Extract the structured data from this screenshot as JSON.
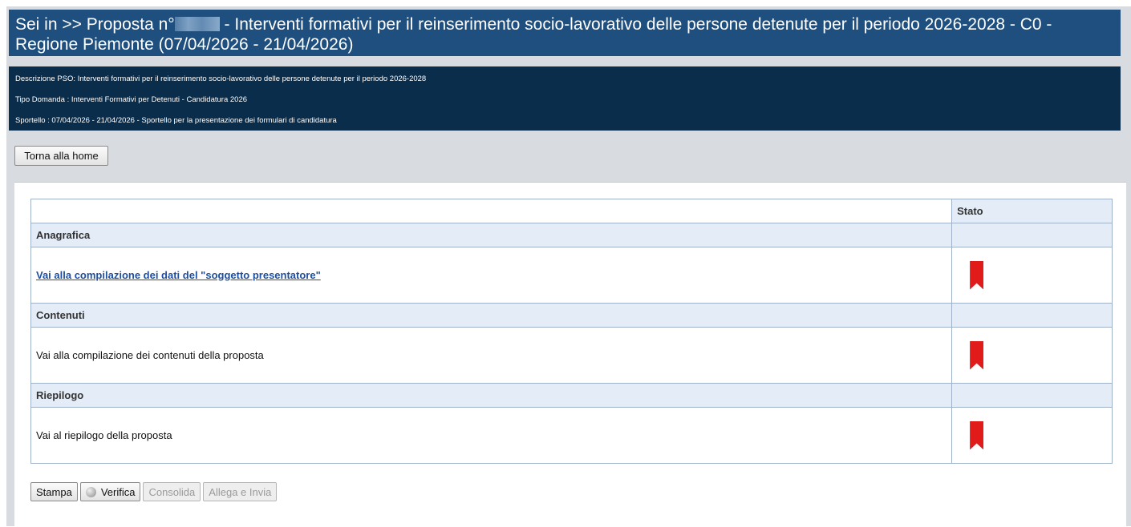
{
  "header": {
    "title_prefix": "Sei in >> Proposta n°",
    "title_suffix": " - Interventi formativi per il reinserimento socio-lavorativo delle persone detenute per il periodo 2026-2028 - C0 - Regione Piemonte (07/04/2026 - 21/04/2026)"
  },
  "info": {
    "descrizione": "Descrizione PSO: Interventi formativi per il reinserimento socio-lavorativo delle persone detenute per il periodo 2026-2028",
    "tipo_domanda": "Tipo Domanda : Interventi Formativi per Detenuti - Candidatura 2026",
    "sportello": "Sportello : 07/04/2026 - 21/04/2026 - Sportello per la presentazione dei formulari di candidatura"
  },
  "home_button": "Torna alla home",
  "table": {
    "col_stato": "Stato",
    "sections": [
      {
        "title": "Anagrafica",
        "item": "Vai alla compilazione dei dati del \"soggetto presentatore\"",
        "item_is_link": true,
        "status": "bookmark-red"
      },
      {
        "title": "Contenuti",
        "item": "Vai alla compilazione dei contenuti della proposta",
        "item_is_link": false,
        "status": "bookmark-red"
      },
      {
        "title": "Riepilogo",
        "item": "Vai al riepilogo della proposta",
        "item_is_link": false,
        "status": "bookmark-red"
      }
    ]
  },
  "buttons": {
    "stampa": "Stampa",
    "verifica": "Verifica",
    "consolida": "Consolida",
    "allega": "Allega e Invia"
  },
  "colors": {
    "title_bg": "#1e4f7e",
    "info_bg": "#0a2d4b",
    "section_bg": "#e4edf7",
    "status_red": "#e11a1a"
  }
}
